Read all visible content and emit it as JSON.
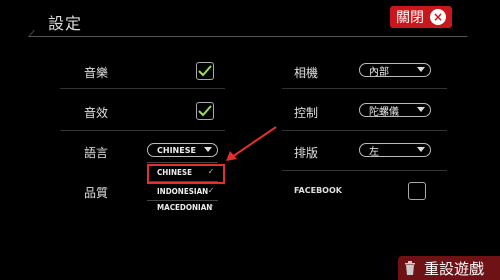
{
  "header": {
    "title": "設定",
    "close_label": "關閉",
    "close_icon": "×"
  },
  "settings": {
    "music_label": "音樂",
    "sound_label": "音效",
    "language_label": "語言",
    "quality_label": "品質",
    "camera_label": "相機",
    "control_label": "控制",
    "layout_label": "排版",
    "facebook_label": "FACEBOOK",
    "language_value": "CHINESE",
    "camera_value": "內部",
    "control_value": "陀螺儀",
    "layout_value": "左"
  },
  "language_dropdown": {
    "items": [
      "CHINESE",
      "INDONESIAN",
      "MACEDONIAN"
    ],
    "selected": "CHINESE"
  },
  "footer": {
    "reset_label": "重設遊戲"
  },
  "colors": {
    "accent": "#c8181e",
    "check": "#9be04a",
    "highlight": "#e03030"
  }
}
